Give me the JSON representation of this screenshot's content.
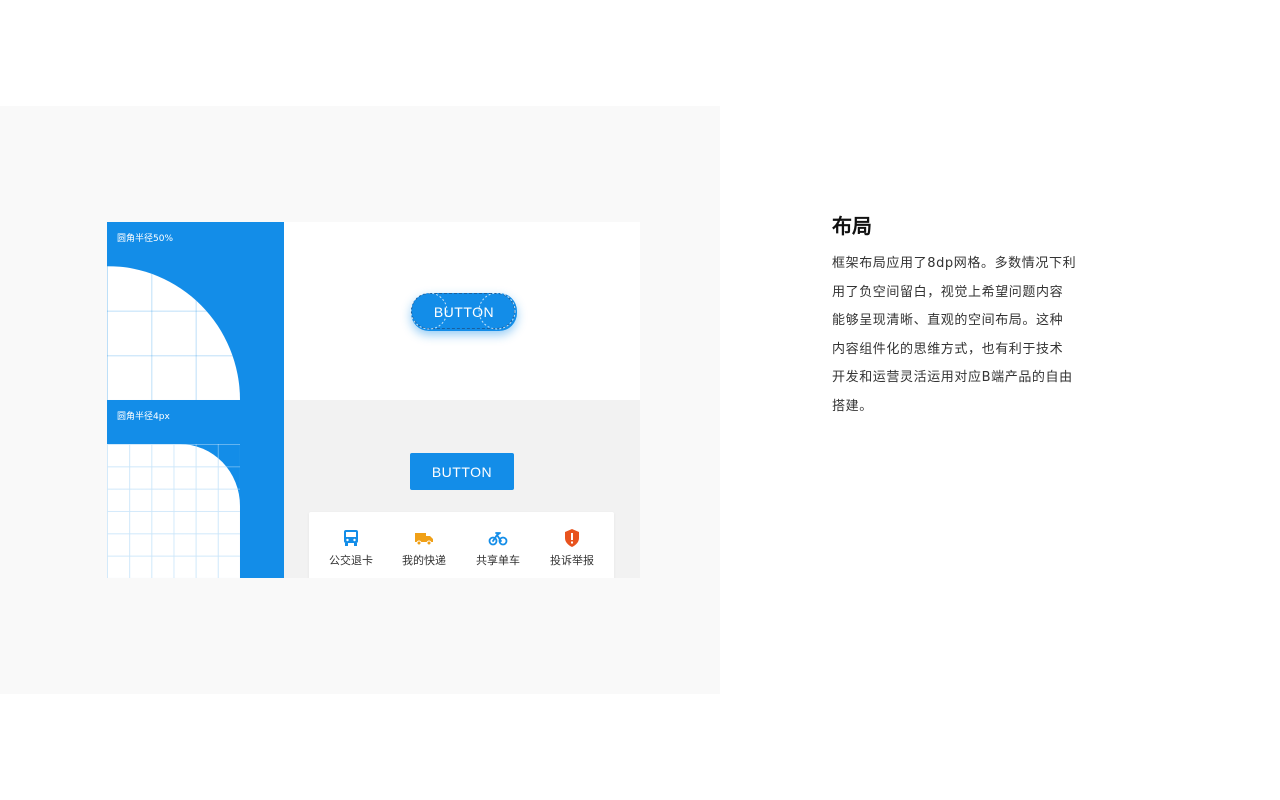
{
  "colors": {
    "primary": "#138de8",
    "stage_bg": "#f9f9f9",
    "panel_gray": "#f2f2f2",
    "bus_icon": "#138de8",
    "truck_icon": "#f0a017",
    "bike_icon": "#138de8",
    "shield_icon": "#e8531e"
  },
  "illustration": {
    "caption_top": "圆角半径50%",
    "caption_bottom": "圆角半径4px",
    "pill_button_label": "BUTTON",
    "rect_button_label": "BUTTON",
    "shortcuts": [
      {
        "label": "公交退卡",
        "icon": "bus-icon"
      },
      {
        "label": "我的快递",
        "icon": "truck-icon"
      },
      {
        "label": "共享单车",
        "icon": "bicycle-icon"
      },
      {
        "label": "投诉举报",
        "icon": "shield-alert-icon"
      }
    ]
  },
  "article": {
    "title": "布局",
    "lines": [
      "框架布局应用了8dp网格。多数情况下利",
      "用了负空间留白，视觉上希望问题内容",
      "能够呈现清晰、直观的空间布局。这种",
      "内容组件化的思维方式，也有利于技术",
      "开发和运营灵活运用对应B端产品的自由",
      "搭建。"
    ]
  }
}
